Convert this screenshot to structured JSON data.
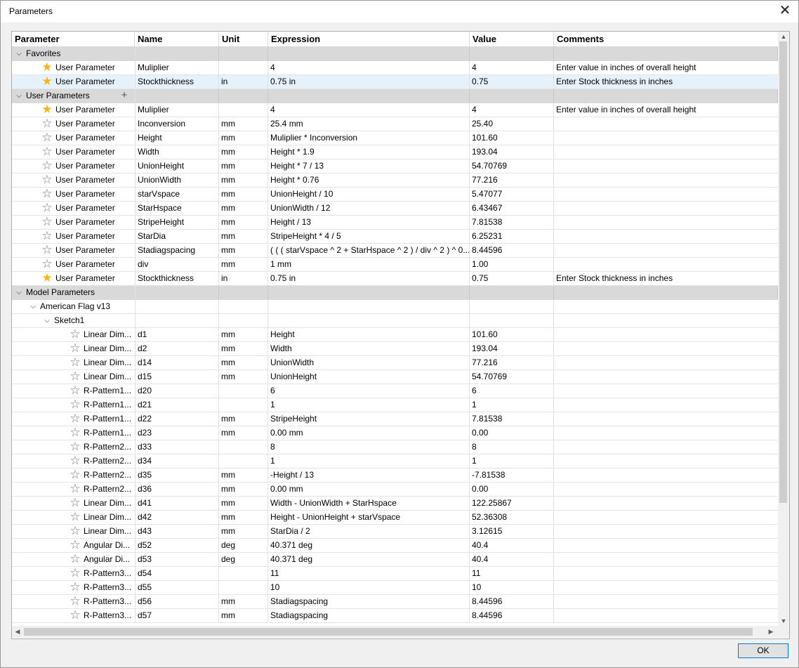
{
  "window": {
    "title": "Parameters",
    "close_glyph": "✕"
  },
  "columns": [
    "Parameter",
    "Name",
    "Unit",
    "Expression",
    "Value",
    "Comments"
  ],
  "footer": {
    "ok_label": "OK"
  },
  "groups": {
    "favorites": "Favorites",
    "user_parameters": "User Parameters",
    "add_glyph": "+",
    "model_parameters": "Model Parameters",
    "component": "American Flag v13",
    "sketch": "Sketch1"
  },
  "icons": {
    "chevron_down": "⌵",
    "star_filled": "★",
    "star_empty": "☆",
    "arrow_up": "▲",
    "arrow_down": "▼",
    "arrow_left": "◀",
    "arrow_right": "▶"
  },
  "colors": {
    "selection": "#e5f1fb",
    "group_band": "#d9d9d9",
    "star_fav": "#f6b417"
  },
  "favorites_rows": [
    {
      "param": "User Parameter",
      "name": "Muliplier",
      "unit": "",
      "expr": "4",
      "value": "4",
      "comment": "Enter value in inches of overall height",
      "fav": true
    },
    {
      "param": "User Parameter",
      "name": "Stockthickness",
      "unit": "in",
      "expr": "0.75 in",
      "value": "0.75",
      "comment": "Enter Stock thickness in inches",
      "fav": true
    }
  ],
  "user_rows": [
    {
      "param": "User Parameter",
      "name": "Muliplier",
      "unit": "",
      "expr": "4",
      "value": "4",
      "comment": "Enter value in inches of overall height",
      "fav": true
    },
    {
      "param": "User Parameter",
      "name": "Inconversion",
      "unit": "mm",
      "expr": "25.4 mm",
      "value": "25.40",
      "comment": "",
      "fav": false
    },
    {
      "param": "User Parameter",
      "name": "Height",
      "unit": "mm",
      "expr": "Muliplier * Inconversion",
      "value": "101.60",
      "comment": "",
      "fav": false
    },
    {
      "param": "User Parameter",
      "name": "Width",
      "unit": "mm",
      "expr": "Height * 1.9",
      "value": "193.04",
      "comment": "",
      "fav": false
    },
    {
      "param": "User Parameter",
      "name": "UnionHeight",
      "unit": "mm",
      "expr": "Height * 7 / 13",
      "value": "54.70769",
      "comment": "",
      "fav": false
    },
    {
      "param": "User Parameter",
      "name": "UnionWidth",
      "unit": "mm",
      "expr": "Height * 0.76",
      "value": "77.216",
      "comment": "",
      "fav": false
    },
    {
      "param": "User Parameter",
      "name": "starVspace",
      "unit": "mm",
      "expr": "UnionHeight / 10",
      "value": "5.47077",
      "comment": "",
      "fav": false
    },
    {
      "param": "User Parameter",
      "name": "StarHspace",
      "unit": "mm",
      "expr": "UnionWidth / 12",
      "value": "6.43467",
      "comment": "",
      "fav": false
    },
    {
      "param": "User Parameter",
      "name": "StripeHeight",
      "unit": "mm",
      "expr": "Height / 13",
      "value": "7.81538",
      "comment": "",
      "fav": false
    },
    {
      "param": "User Parameter",
      "name": "StarDia",
      "unit": "mm",
      "expr": "StripeHeight * 4 / 5",
      "value": "6.25231",
      "comment": "",
      "fav": false
    },
    {
      "param": "User Parameter",
      "name": "Stadiagspacing",
      "unit": "mm",
      "expr": "( ( ( starVspace ^ 2 + StarHspace ^ 2 ) / div ^ 2 ) ^ 0...",
      "value": "8.44596",
      "comment": "",
      "fav": false
    },
    {
      "param": "User Parameter",
      "name": "div",
      "unit": "mm",
      "expr": "1 mm",
      "value": "1.00",
      "comment": "",
      "fav": false
    },
    {
      "param": "User Parameter",
      "name": "Stockthickness",
      "unit": "in",
      "expr": "0.75 in",
      "value": "0.75",
      "comment": "Enter Stock thickness in inches",
      "fav": true
    }
  ],
  "model_rows": [
    {
      "param": "Linear Dim...",
      "name": "d1",
      "unit": "mm",
      "expr": "Height",
      "value": "101.60"
    },
    {
      "param": "Linear Dim...",
      "name": "d2",
      "unit": "mm",
      "expr": "Width",
      "value": "193.04"
    },
    {
      "param": "Linear Dim...",
      "name": "d14",
      "unit": "mm",
      "expr": "UnionWidth",
      "value": "77.216"
    },
    {
      "param": "Linear Dim...",
      "name": "d15",
      "unit": "mm",
      "expr": "UnionHeight",
      "value": "54.70769"
    },
    {
      "param": "R-Pattern1...",
      "name": "d20",
      "unit": "",
      "expr": "6",
      "value": "6"
    },
    {
      "param": "R-Pattern1...",
      "name": "d21",
      "unit": "",
      "expr": "1",
      "value": "1"
    },
    {
      "param": "R-Pattern1...",
      "name": "d22",
      "unit": "mm",
      "expr": "StripeHeight",
      "value": "7.81538"
    },
    {
      "param": "R-Pattern1...",
      "name": "d23",
      "unit": "mm",
      "expr": "0.00 mm",
      "value": "0.00"
    },
    {
      "param": "R-Pattern2...",
      "name": "d33",
      "unit": "",
      "expr": "8",
      "value": "8"
    },
    {
      "param": "R-Pattern2...",
      "name": "d34",
      "unit": "",
      "expr": "1",
      "value": "1"
    },
    {
      "param": "R-Pattern2...",
      "name": "d35",
      "unit": "mm",
      "expr": "-Height / 13",
      "value": "-7.81538"
    },
    {
      "param": "R-Pattern2...",
      "name": "d36",
      "unit": "mm",
      "expr": "0.00 mm",
      "value": "0.00"
    },
    {
      "param": "Linear Dim...",
      "name": "d41",
      "unit": "mm",
      "expr": "Width - UnionWidth + StarHspace",
      "value": "122.25867"
    },
    {
      "param": "Linear Dim...",
      "name": "d42",
      "unit": "mm",
      "expr": "Height - UnionHeight + starVspace",
      "value": "52.36308"
    },
    {
      "param": "Linear Dim...",
      "name": "d43",
      "unit": "mm",
      "expr": "StarDia / 2",
      "value": "3.12615"
    },
    {
      "param": "Angular Di...",
      "name": "d52",
      "unit": "deg",
      "expr": "40.371 deg",
      "value": "40.4"
    },
    {
      "param": "Angular Di...",
      "name": "d53",
      "unit": "deg",
      "expr": "40.371 deg",
      "value": "40.4"
    },
    {
      "param": "R-Pattern3...",
      "name": "d54",
      "unit": "",
      "expr": "11",
      "value": "11"
    },
    {
      "param": "R-Pattern3...",
      "name": "d55",
      "unit": "",
      "expr": "10",
      "value": "10"
    },
    {
      "param": "R-Pattern3...",
      "name": "d56",
      "unit": "mm",
      "expr": "Stadiagspacing",
      "value": "8.44596"
    },
    {
      "param": "R-Pattern3...",
      "name": "d57",
      "unit": "mm",
      "expr": "Stadiagspacing",
      "value": "8.44596"
    }
  ]
}
